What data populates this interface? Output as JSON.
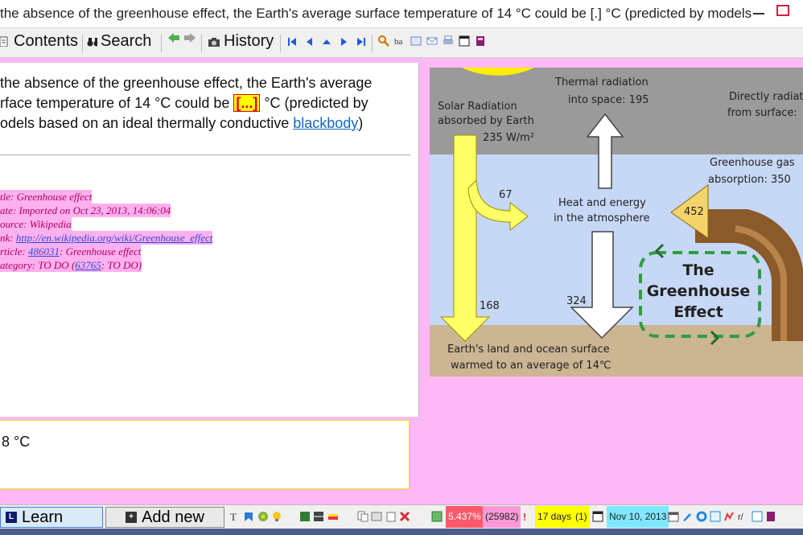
{
  "window": {
    "title": "the absence of the greenhouse effect, the Earth's average surface temperature of 14 °C could be [.] °C (predicted by models ..."
  },
  "toolbar": {
    "contents_label": "Contents",
    "search_label": "Search",
    "history_label": "History"
  },
  "question": {
    "line1": "the absence of the greenhouse effect, the Earth's average",
    "line2_pre": "rface temperature of 14 °C could be ",
    "cloze": "[...]",
    "line2_post": " °C (predicted by",
    "line3_pre": "odels based on an ideal thermally conductive ",
    "link": "blackbody",
    "line3_post": ")"
  },
  "meta": {
    "title": "tle: Greenhouse effect",
    "date": "ate: Imported on Oct 23, 2013, 14:06:04",
    "source": "ource: Wikipedia",
    "link_prefix": "nk: ",
    "link_url": "http://en.wikipedia.org/wiki/Greenhouse_effect",
    "article_prefix": "rticle: ",
    "article_id": "486031",
    "article_suffix": ": Greenhouse effect",
    "category_prefix": "ategory: TO DO (",
    "category_id": "63765",
    "category_suffix": ": TO DO)"
  },
  "answer": {
    "text": "8 °C"
  },
  "diagram": {
    "solar_radiation": "Solar Radiation",
    "absorbed_by": "absorbed by Earth",
    "solar_value": "235 W/m²",
    "thermal1": "Thermal radiation",
    "thermal2": "into space: 195",
    "direct1": "Directly radiat",
    "direct2": "from surface: ",
    "gh_gas1": "Greenhouse gas",
    "gh_gas2": "absorption: 350",
    "v67": "67",
    "heat1": "Heat and energy",
    "heat2": "in the atmosphere",
    "v452": "452",
    "the": "The",
    "greenhouse": "Greenhouse",
    "effect": "Effect",
    "v168": "168",
    "v324": "324",
    "land1": "Earth's land and ocean surface",
    "land2": "warmed to an average of 14℃"
  },
  "statusbar": {
    "learn_label": "Learn",
    "add_new_label": "Add new",
    "percent": "5.437%",
    "count": "(25982)",
    "days": "17 days",
    "days_count": "(1)",
    "date": "Nov 10, 2013"
  },
  "colors": {
    "cloze_red": "#e3001b",
    "highlight_yellow": "#ffff00",
    "pink_bg": "#fdb8f5",
    "meta_pink": "#ffb0ef"
  }
}
